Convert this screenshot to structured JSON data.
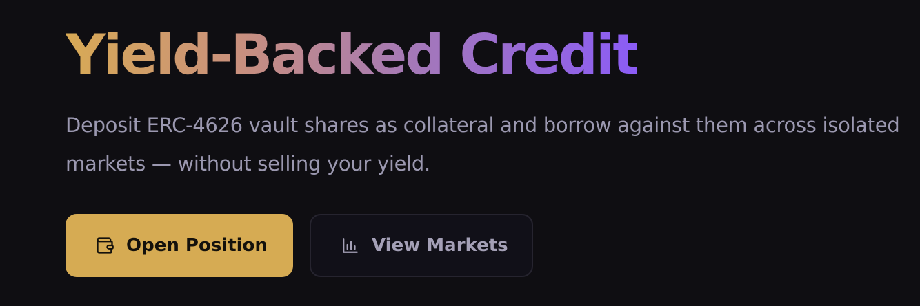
{
  "hero": {
    "title": "Yield-Backed Credit",
    "subtitle": "Deposit ERC-4626 vault shares as collateral and borrow against them across isolated markets — without selling your yield."
  },
  "actions": {
    "primary": {
      "label": "Open Position",
      "icon": "wallet-icon"
    },
    "secondary": {
      "label": "View Markets",
      "icon": "bar-chart-icon"
    }
  },
  "colors": {
    "background": "#0f0e12",
    "title_gradient_start": "#d8aa55",
    "title_gradient_end": "#8b5cf6",
    "subtitle": "#9b98b0",
    "primary_button": "#d6ab53",
    "secondary_button_border": "#26242f"
  }
}
